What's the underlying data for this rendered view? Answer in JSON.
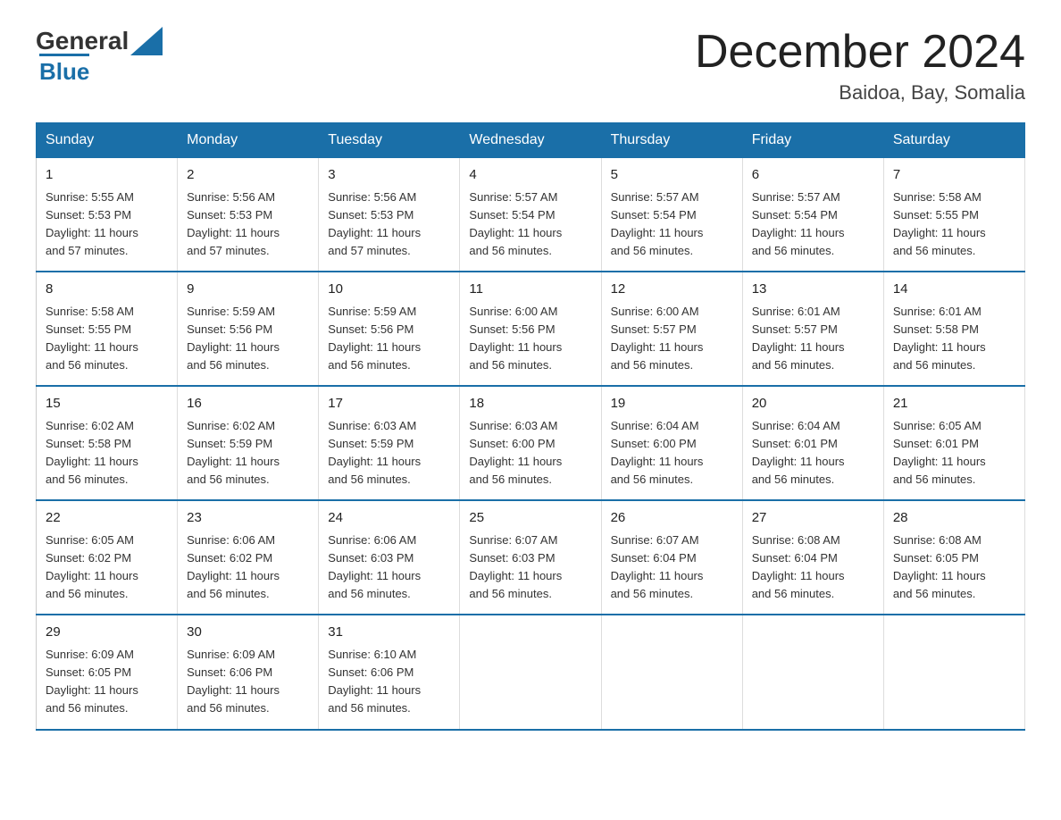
{
  "logo": {
    "general": "General",
    "blue": "Blue"
  },
  "title": "December 2024",
  "subtitle": "Baidoa, Bay, Somalia",
  "days_of_week": [
    "Sunday",
    "Monday",
    "Tuesday",
    "Wednesday",
    "Thursday",
    "Friday",
    "Saturday"
  ],
  "weeks": [
    [
      {
        "day": "1",
        "sunrise": "5:55 AM",
        "sunset": "5:53 PM",
        "daylight": "11 hours and 57 minutes."
      },
      {
        "day": "2",
        "sunrise": "5:56 AM",
        "sunset": "5:53 PM",
        "daylight": "11 hours and 57 minutes."
      },
      {
        "day": "3",
        "sunrise": "5:56 AM",
        "sunset": "5:53 PM",
        "daylight": "11 hours and 57 minutes."
      },
      {
        "day": "4",
        "sunrise": "5:57 AM",
        "sunset": "5:54 PM",
        "daylight": "11 hours and 56 minutes."
      },
      {
        "day": "5",
        "sunrise": "5:57 AM",
        "sunset": "5:54 PM",
        "daylight": "11 hours and 56 minutes."
      },
      {
        "day": "6",
        "sunrise": "5:57 AM",
        "sunset": "5:54 PM",
        "daylight": "11 hours and 56 minutes."
      },
      {
        "day": "7",
        "sunrise": "5:58 AM",
        "sunset": "5:55 PM",
        "daylight": "11 hours and 56 minutes."
      }
    ],
    [
      {
        "day": "8",
        "sunrise": "5:58 AM",
        "sunset": "5:55 PM",
        "daylight": "11 hours and 56 minutes."
      },
      {
        "day": "9",
        "sunrise": "5:59 AM",
        "sunset": "5:56 PM",
        "daylight": "11 hours and 56 minutes."
      },
      {
        "day": "10",
        "sunrise": "5:59 AM",
        "sunset": "5:56 PM",
        "daylight": "11 hours and 56 minutes."
      },
      {
        "day": "11",
        "sunrise": "6:00 AM",
        "sunset": "5:56 PM",
        "daylight": "11 hours and 56 minutes."
      },
      {
        "day": "12",
        "sunrise": "6:00 AM",
        "sunset": "5:57 PM",
        "daylight": "11 hours and 56 minutes."
      },
      {
        "day": "13",
        "sunrise": "6:01 AM",
        "sunset": "5:57 PM",
        "daylight": "11 hours and 56 minutes."
      },
      {
        "day": "14",
        "sunrise": "6:01 AM",
        "sunset": "5:58 PM",
        "daylight": "11 hours and 56 minutes."
      }
    ],
    [
      {
        "day": "15",
        "sunrise": "6:02 AM",
        "sunset": "5:58 PM",
        "daylight": "11 hours and 56 minutes."
      },
      {
        "day": "16",
        "sunrise": "6:02 AM",
        "sunset": "5:59 PM",
        "daylight": "11 hours and 56 minutes."
      },
      {
        "day": "17",
        "sunrise": "6:03 AM",
        "sunset": "5:59 PM",
        "daylight": "11 hours and 56 minutes."
      },
      {
        "day": "18",
        "sunrise": "6:03 AM",
        "sunset": "6:00 PM",
        "daylight": "11 hours and 56 minutes."
      },
      {
        "day": "19",
        "sunrise": "6:04 AM",
        "sunset": "6:00 PM",
        "daylight": "11 hours and 56 minutes."
      },
      {
        "day": "20",
        "sunrise": "6:04 AM",
        "sunset": "6:01 PM",
        "daylight": "11 hours and 56 minutes."
      },
      {
        "day": "21",
        "sunrise": "6:05 AM",
        "sunset": "6:01 PM",
        "daylight": "11 hours and 56 minutes."
      }
    ],
    [
      {
        "day": "22",
        "sunrise": "6:05 AM",
        "sunset": "6:02 PM",
        "daylight": "11 hours and 56 minutes."
      },
      {
        "day": "23",
        "sunrise": "6:06 AM",
        "sunset": "6:02 PM",
        "daylight": "11 hours and 56 minutes."
      },
      {
        "day": "24",
        "sunrise": "6:06 AM",
        "sunset": "6:03 PM",
        "daylight": "11 hours and 56 minutes."
      },
      {
        "day": "25",
        "sunrise": "6:07 AM",
        "sunset": "6:03 PM",
        "daylight": "11 hours and 56 minutes."
      },
      {
        "day": "26",
        "sunrise": "6:07 AM",
        "sunset": "6:04 PM",
        "daylight": "11 hours and 56 minutes."
      },
      {
        "day": "27",
        "sunrise": "6:08 AM",
        "sunset": "6:04 PM",
        "daylight": "11 hours and 56 minutes."
      },
      {
        "day": "28",
        "sunrise": "6:08 AM",
        "sunset": "6:05 PM",
        "daylight": "11 hours and 56 minutes."
      }
    ],
    [
      {
        "day": "29",
        "sunrise": "6:09 AM",
        "sunset": "6:05 PM",
        "daylight": "11 hours and 56 minutes."
      },
      {
        "day": "30",
        "sunrise": "6:09 AM",
        "sunset": "6:06 PM",
        "daylight": "11 hours and 56 minutes."
      },
      {
        "day": "31",
        "sunrise": "6:10 AM",
        "sunset": "6:06 PM",
        "daylight": "11 hours and 56 minutes."
      },
      {
        "day": "",
        "sunrise": "",
        "sunset": "",
        "daylight": ""
      },
      {
        "day": "",
        "sunrise": "",
        "sunset": "",
        "daylight": ""
      },
      {
        "day": "",
        "sunrise": "",
        "sunset": "",
        "daylight": ""
      },
      {
        "day": "",
        "sunrise": "",
        "sunset": "",
        "daylight": ""
      }
    ]
  ],
  "labels": {
    "sunrise": "Sunrise:",
    "sunset": "Sunset:",
    "daylight": "Daylight:"
  }
}
